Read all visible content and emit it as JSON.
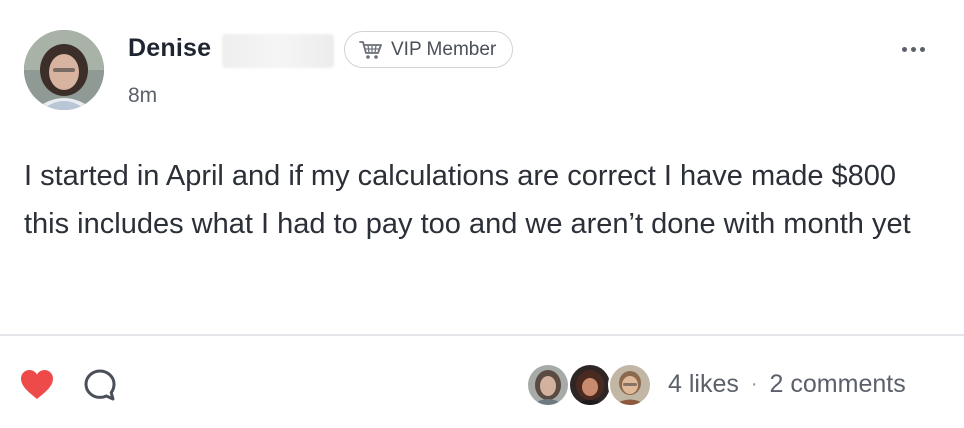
{
  "post": {
    "author": {
      "name": "Denise",
      "avatar_icon": "profile-photo-avatar"
    },
    "badge": {
      "icon": "shopping-cart-icon",
      "label": "VIP Member"
    },
    "timestamp": "8m",
    "menu_icon": "more-options-icon",
    "text": "I started in April and if my calculations are correct I have made $800 this includes what I had to pay too and we aren’t done with month yet"
  },
  "footer": {
    "like_icon": "heart-icon",
    "comment_icon": "comment-bubble-icon",
    "liker_avatars": [
      "liker-avatar-1",
      "liker-avatar-2",
      "liker-avatar-3"
    ],
    "likes_label": "4 likes",
    "separator": "·",
    "comments_label": "2 comments"
  },
  "colors": {
    "like_heart": "#ef4a4a",
    "text_primary": "#2b2f38",
    "text_secondary": "#5b606a",
    "divider": "#e3e5e8",
    "badge_border": "#cfd3d8"
  }
}
